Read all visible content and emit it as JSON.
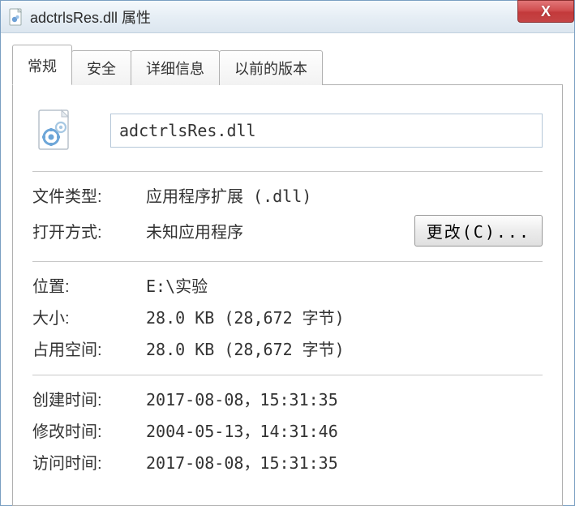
{
  "window": {
    "title": "adctrlsRes.dll 属性",
    "close_glyph": "X"
  },
  "tabs": {
    "general": "常规",
    "security": "安全",
    "details": "详细信息",
    "previous": "以前的版本"
  },
  "file": {
    "name": "adctrlsRes.dll"
  },
  "labels": {
    "file_type": "文件类型:",
    "opens_with": "打开方式:",
    "location": "位置:",
    "size": "大小:",
    "size_on_disk": "占用空间:",
    "created": "创建时间:",
    "modified": "修改时间:",
    "accessed": "访问时间:",
    "change_button": "更改(C)..."
  },
  "values": {
    "file_type": "应用程序扩展 (.dll)",
    "opens_with": "未知应用程序",
    "location": "E:\\实验",
    "size": "28.0 KB (28,672 字节)",
    "size_on_disk": "28.0 KB (28,672 字节)",
    "created": "2017-08-08，15:31:35",
    "modified": "2004-05-13，14:31:46",
    "accessed": "2017-08-08，15:31:35"
  }
}
